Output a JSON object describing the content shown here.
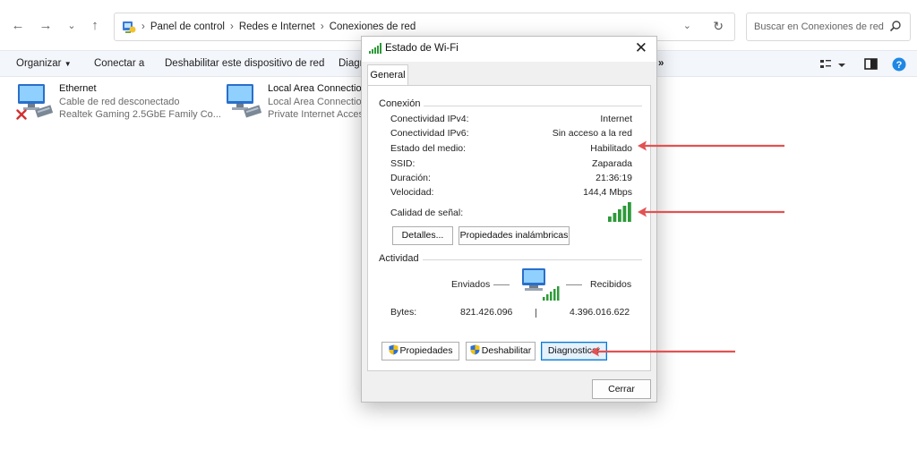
{
  "explorer": {
    "breadcrumb": [
      "Panel de control",
      "Redes e Internet",
      "Conexiones de red"
    ],
    "search_placeholder": "Buscar en Conexiones de red",
    "commands": {
      "organize": "Organizar",
      "connect": "Conectar a",
      "disable": "Deshabilitar este dispositivo de red",
      "diagnose_partial": "Diagn"
    },
    "overflow": "»",
    "connections": [
      {
        "name": "Ethernet",
        "status": "Cable de red desconectado",
        "adapter": "Realtek Gaming 2.5GbE Family Co..."
      },
      {
        "name": "Local Area Connectio",
        "status": "Local Area Connectio",
        "adapter": "Private Internet Acces"
      }
    ]
  },
  "dialog": {
    "title": "Estado de Wi-Fi",
    "tab": "General",
    "connection_group": "Conexión",
    "rows": [
      {
        "label": "Conectividad IPv4:",
        "value": "Internet"
      },
      {
        "label": "Conectividad IPv6:",
        "value": "Sin acceso a la red"
      },
      {
        "label": "Estado del medio:",
        "value": "Habilitado"
      },
      {
        "label": "SSID:",
        "value": "Zaparada"
      },
      {
        "label": "Duración:",
        "value": "21:36:19"
      },
      {
        "label": "Velocidad:",
        "value": "144,4 Mbps"
      }
    ],
    "signal_label": "Calidad de señal:",
    "signal_bars": 5,
    "signal_max": 5,
    "details_button": "Detalles...",
    "wireless_props_button": "Propiedades inalámbricas",
    "activity_group": "Actividad",
    "sent_label": "Enviados",
    "received_label": "Recibidos",
    "bytes_label": "Bytes:",
    "bytes_sent": "821.426.096",
    "bytes_received": "4.396.016.622",
    "properties_button": "Propiedades",
    "disable_button": "Deshabilitar",
    "diagnose_button": "Diagnosticar",
    "close_button": "Cerrar"
  },
  "colors": {
    "accent": "#0078d7",
    "signal_green": "#2e9a3a",
    "annotation_red": "#e25252",
    "error_red": "#d32f2f"
  }
}
